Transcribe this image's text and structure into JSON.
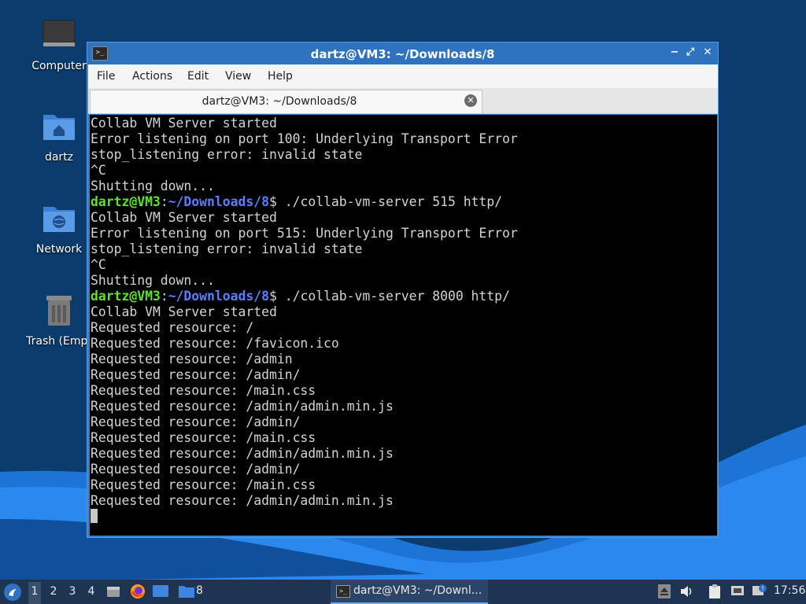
{
  "desktop": {
    "icons": [
      {
        "label": "Computer",
        "icon": "computer-icon"
      },
      {
        "label": "dartz",
        "icon": "home-folder-icon"
      },
      {
        "label": "Network",
        "icon": "network-folder-icon"
      },
      {
        "label": "Trash (Empt",
        "icon": "trash-icon"
      }
    ]
  },
  "window": {
    "title": "dartz@VM3: ~/Downloads/8",
    "menu": [
      "File",
      "Actions",
      "Edit",
      "View",
      "Help"
    ],
    "tab_title": "dartz@VM3: ~/Downloads/8",
    "terminal": {
      "prompt_user": "dartz@VM3",
      "prompt_sep": ":",
      "prompt_path": "~/Downloads/8",
      "prompt_end": "$",
      "lines": [
        {
          "text": "Collab VM Server started"
        },
        {
          "text": "Error listening on port 100: Underlying Transport Error"
        },
        {
          "text": "stop_listening error: invalid state"
        },
        {
          "text": "^C"
        },
        {
          "text": "Shutting down..."
        },
        {
          "prompt": true,
          "cmd": " ./collab-vm-server 515 http/"
        },
        {
          "text": "Collab VM Server started"
        },
        {
          "text": "Error listening on port 515: Underlying Transport Error"
        },
        {
          "text": "stop_listening error: invalid state"
        },
        {
          "text": "^C"
        },
        {
          "text": "Shutting down..."
        },
        {
          "prompt": true,
          "cmd": " ./collab-vm-server 8000 http/"
        },
        {
          "text": "Collab VM Server started"
        },
        {
          "text": "Requested resource: /"
        },
        {
          "text": "Requested resource: /favicon.ico"
        },
        {
          "text": "Requested resource: /admin"
        },
        {
          "text": "Requested resource: /admin/"
        },
        {
          "text": "Requested resource: /main.css"
        },
        {
          "text": "Requested resource: /admin/admin.min.js"
        },
        {
          "text": "Requested resource: /admin/"
        },
        {
          "text": "Requested resource: /main.css"
        },
        {
          "text": "Requested resource: /admin/admin.min.js"
        },
        {
          "text": "Requested resource: /admin/"
        },
        {
          "text": "Requested resource: /main.css"
        },
        {
          "text": "Requested resource: /admin/admin.min.js"
        }
      ]
    }
  },
  "taskbar": {
    "workspaces": [
      "1",
      "2",
      "3",
      "4"
    ],
    "active_workspace": "1",
    "folder_badge": "8",
    "task_label": "dartz@VM3: ~/Downl...",
    "clock": "17:56"
  },
  "colors": {
    "titlebar": "#2f72c0",
    "prompt_user": "#5fe22c",
    "prompt_path": "#5c7cff",
    "taskbar": "#1f3452"
  }
}
